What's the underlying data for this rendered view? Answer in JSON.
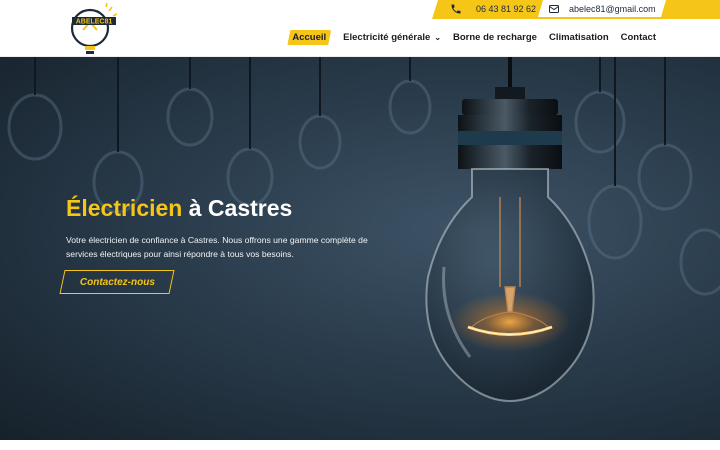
{
  "topbar": {
    "phone": "06 43 81 92 62",
    "email": "abelec81@gmail.com",
    "phone_icon": "phone-icon",
    "email_icon": "mail-icon"
  },
  "brand": {
    "logo_text": "ABELEC81",
    "accent_color": "#f5c518",
    "dark_color": "#1e2a3a"
  },
  "nav": {
    "items": [
      {
        "label": "Accueil",
        "active": true
      },
      {
        "label": "Electricité générale",
        "has_dropdown": true
      },
      {
        "label": "Borne de recharge"
      },
      {
        "label": "Climatisation"
      },
      {
        "label": "Contact"
      }
    ]
  },
  "hero": {
    "title_highlight": "Électricien",
    "title_rest": " à Castres",
    "description": "Votre électricien de confiance à Castres. Nous offrons une gamme complète de services électriques pour ainsi répondre à tous vos besoins.",
    "cta_label": "Contactez-nous"
  }
}
